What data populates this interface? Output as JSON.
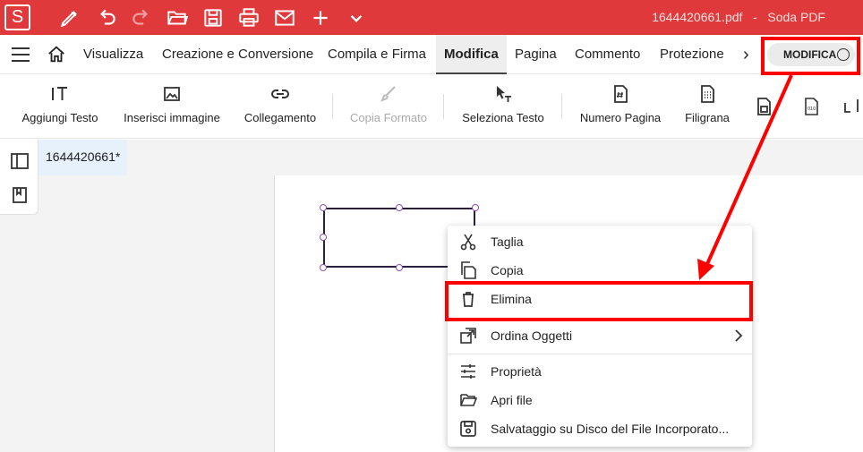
{
  "app": {
    "logo_letter": "S",
    "title": "1644420661.pdf   -   Soda PDF",
    "accent_color": "#e0393b"
  },
  "titlebar_icons": [
    "pen-icon",
    "undo-icon",
    "redo-icon",
    "open-folder-icon",
    "save-icon",
    "print-icon",
    "mail-icon",
    "plus-icon",
    "chevron-down-icon"
  ],
  "menu": {
    "items": [
      "Visualizza",
      "Creazione e Conversione",
      "Compila e Firma",
      "Modifica",
      "Pagina",
      "Commento",
      "Protezione"
    ],
    "active": "Modifica",
    "more": "›",
    "mode_label": "MODIFICA"
  },
  "toolbar": {
    "tools": [
      {
        "label": "Aggiungi Testo",
        "icon": "add-text-icon",
        "disabled": false
      },
      {
        "label": "Inserisci immagine",
        "icon": "image-icon",
        "disabled": false
      },
      {
        "label": "Collegamento",
        "icon": "link-icon",
        "disabled": false
      },
      {
        "label": "Copia Formato",
        "icon": "brush-icon",
        "disabled": true
      },
      {
        "label": "Seleziona Testo",
        "icon": "select-text-icon",
        "disabled": false
      },
      {
        "label": "Numero Pagina",
        "icon": "page-number-icon",
        "disabled": false
      },
      {
        "label": "Filigrana",
        "icon": "watermark-icon",
        "disabled": false
      }
    ]
  },
  "document": {
    "tab_name": "1644420661*"
  },
  "context_menu": {
    "items": [
      {
        "label": "Taglia",
        "icon": "scissors-icon"
      },
      {
        "label": "Copia",
        "icon": "copy-icon"
      },
      {
        "label": "Elimina",
        "icon": "trash-icon"
      },
      {
        "label": "Ordina Oggetti",
        "icon": "arrange-icon",
        "submenu": true
      },
      {
        "label": "Proprietà",
        "icon": "sliders-icon"
      },
      {
        "label": "Apri file",
        "icon": "folder-open-icon"
      },
      {
        "label": "Salvataggio su Disco del File Incorporato...",
        "icon": "disk-icon"
      }
    ]
  },
  "annotation_color": "#ff0000"
}
